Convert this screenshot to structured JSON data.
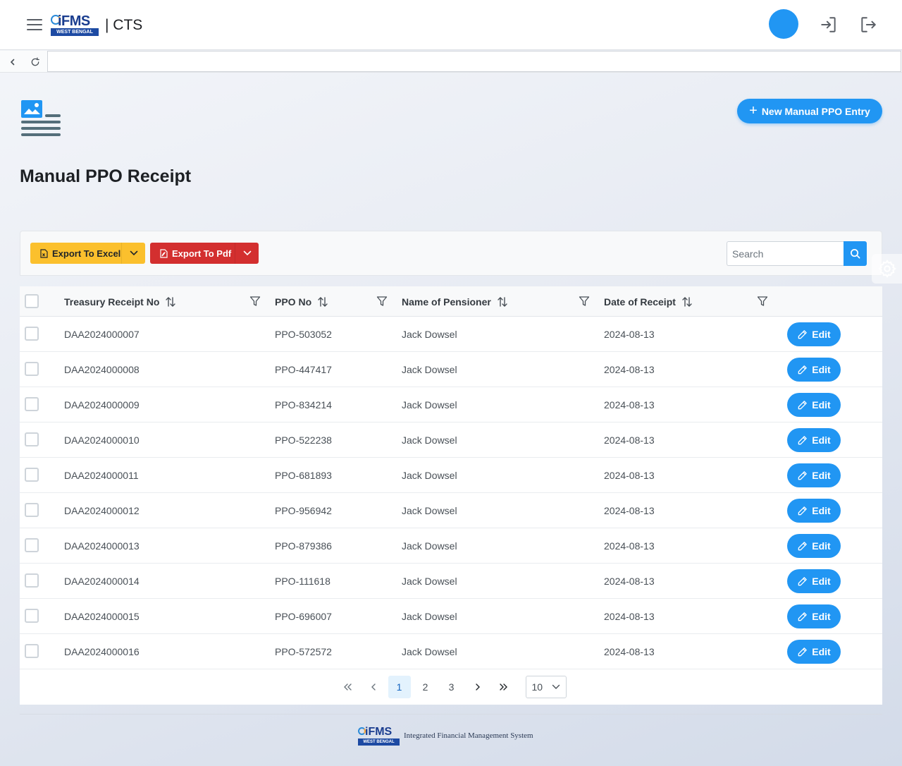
{
  "header": {
    "logo_text": "iFMS",
    "logo_subtext": "WEST BENGAL",
    "app_title": "| CTS"
  },
  "navbar": {
    "url_value": ""
  },
  "page": {
    "title": "Manual PPO Receipt",
    "new_entry_label": "New Manual PPO Entry"
  },
  "toolbar": {
    "export_excel_label": "Export To Excel",
    "export_pdf_label": "Export To Pdf",
    "search_placeholder": "Search"
  },
  "table": {
    "columns": [
      "Treasury Receipt No",
      "PPO No",
      "Name of Pensioner",
      "Date of Receipt"
    ],
    "edit_label": "Edit",
    "rows": [
      {
        "receipt": "DAA2024000007",
        "ppo": "PPO-503052",
        "name": "Jack Dowsel",
        "date": "2024-08-13"
      },
      {
        "receipt": "DAA2024000008",
        "ppo": "PPO-447417",
        "name": "Jack Dowsel",
        "date": "2024-08-13"
      },
      {
        "receipt": "DAA2024000009",
        "ppo": "PPO-834214",
        "name": "Jack Dowsel",
        "date": "2024-08-13"
      },
      {
        "receipt": "DAA2024000010",
        "ppo": "PPO-522238",
        "name": "Jack Dowsel",
        "date": "2024-08-13"
      },
      {
        "receipt": "DAA2024000011",
        "ppo": "PPO-681893",
        "name": "Jack Dowsel",
        "date": "2024-08-13"
      },
      {
        "receipt": "DAA2024000012",
        "ppo": "PPO-956942",
        "name": "Jack Dowsel",
        "date": "2024-08-13"
      },
      {
        "receipt": "DAA2024000013",
        "ppo": "PPO-879386",
        "name": "Jack Dowsel",
        "date": "2024-08-13"
      },
      {
        "receipt": "DAA2024000014",
        "ppo": "PPO-111618",
        "name": "Jack Dowsel",
        "date": "2024-08-13"
      },
      {
        "receipt": "DAA2024000015",
        "ppo": "PPO-696007",
        "name": "Jack Dowsel",
        "date": "2024-08-13"
      },
      {
        "receipt": "DAA2024000016",
        "ppo": "PPO-572572",
        "name": "Jack Dowsel",
        "date": "2024-08-13"
      }
    ]
  },
  "pagination": {
    "pages": [
      "1",
      "2",
      "3"
    ],
    "current_page": "1",
    "rows_per_page": "10"
  },
  "footer": {
    "logo_text": "iFMS",
    "logo_subtext": "WEST BENGAL",
    "system_name": "Integrated Financial Management System"
  },
  "colors": {
    "primary": "#2196f3",
    "excel": "#fbc02d",
    "pdf": "#d32f2f"
  }
}
